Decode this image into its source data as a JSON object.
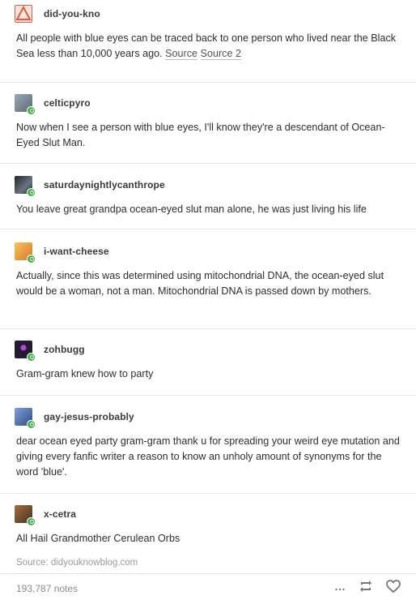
{
  "posts": [
    {
      "username": "did-you-kno",
      "text": "All people with blue eyes can be traced back to one person who lived near the Black Sea less than 10,000 years ago.",
      "sources": [
        "Source",
        "Source 2"
      ],
      "avatar_color": "#e15a3c"
    },
    {
      "username": "celticpyro",
      "text": "Now when I see a person with blue eyes, I'll know they're a descendant of Ocean-Eyed Slut Man.",
      "avatar_color": "#6d7e8a"
    },
    {
      "username": "saturdaynightlycanthrope",
      "text": "You leave great grandpa ocean-eyed slut man alone, he was just living his life",
      "avatar_color": "#3a3f4a"
    },
    {
      "username": "i-want-cheese",
      "text": "Actually, since this was determined using mitochondrial DNA, the ocean-eyed slut would be a woman, not a man. Mitochondrial DNA is passed down by mothers.",
      "avatar_color": "#e8a53a"
    },
    {
      "username": "zohbugg",
      "text": "Gram-gram knew how to party",
      "avatar_color": "#2a1f3a"
    },
    {
      "username": "gay-jesus-probably",
      "text": "dear ocean eyed party gram-gram thank u for spreading your weird eye mutation and giving every fanfic writer a reason to know an unholy amount of synonyms for the word 'blue'.",
      "avatar_color": "#4b6aa8"
    },
    {
      "username": "x-cetra",
      "text": "All Hail Grandmother Cerulean Orbs",
      "avatar_color": "#6b4a2e"
    }
  ],
  "footer": {
    "source_label": "Source:",
    "source_domain": "didyouknowblog.com",
    "notes": "193,787 notes",
    "more_icon": "…",
    "reblog_icon": "reblog-icon",
    "like_icon": "heart-icon"
  }
}
